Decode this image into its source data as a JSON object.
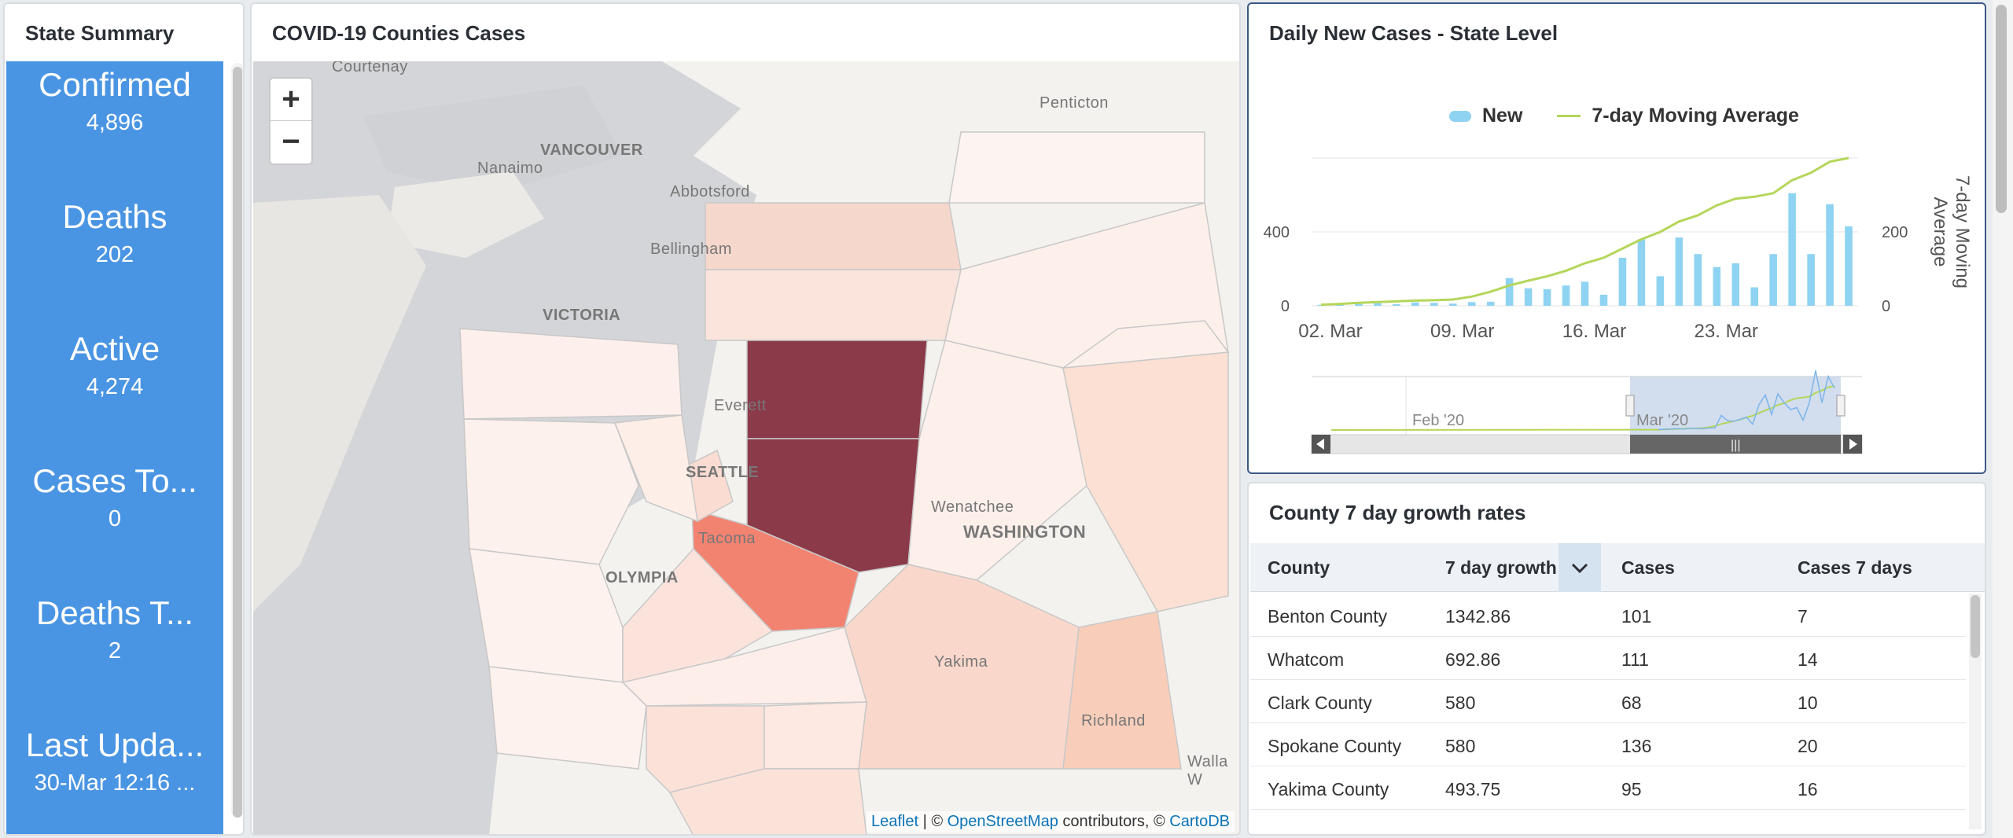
{
  "summary": {
    "title": "State Summary",
    "items": [
      {
        "label": "Confirmed",
        "value": "4,896"
      },
      {
        "label": "Deaths",
        "value": "202"
      },
      {
        "label": "Active",
        "value": "4,274"
      },
      {
        "label": "Cases To...",
        "value": "0"
      },
      {
        "label": "Deaths T...",
        "value": "2"
      },
      {
        "label": "Last Upda...",
        "value": "30-Mar 12:16 ..."
      }
    ]
  },
  "map": {
    "title": "COVID-19 Counties Cases",
    "zoom_in": "+",
    "zoom_out": "−",
    "places": [
      "Courtenay",
      "Penticton",
      "VANCOUVER",
      "Nanaimo",
      "Abbotsford",
      "Bellingham",
      "VICTORIA",
      "Everett",
      "SEATTLE",
      "Tacoma",
      "OLYMPIA",
      "Wenatchee",
      "WASHINGTON",
      "Yakima",
      "Richland",
      "Walla W"
    ],
    "attribution": {
      "leaflet": "Leaflet",
      "sep1": " | © ",
      "osm": "OpenStreetMap",
      "mid": " contributors, © ",
      "carto": "CartoDB"
    },
    "colors": {
      "water": "#d4d5d8",
      "land": "#f3f2ef",
      "darkest": "#8b3a49",
      "high": "#f38371"
    }
  },
  "chart": {
    "title": "Daily New Cases - State Level",
    "legend_new": "New",
    "legend_avg": "7-day Moving Average",
    "navigator_labels": [
      "Feb '20",
      "Mar '20"
    ]
  },
  "chart_data": {
    "type": "bar",
    "title": "Daily New Cases - State Level",
    "x_tick_labels": [
      "02. Mar",
      "09. Mar",
      "16. Mar",
      "23. Mar"
    ],
    "y_left": {
      "ticks": [
        "0",
        "400"
      ],
      "range": [
        0,
        800
      ]
    },
    "y_right": {
      "label": "7-day Moving Average",
      "ticks": [
        "0",
        "200"
      ],
      "range": [
        0,
        400
      ]
    },
    "dates": [
      "Mar 1",
      "Mar 2",
      "Mar 3",
      "Mar 4",
      "Mar 5",
      "Mar 6",
      "Mar 7",
      "Mar 8",
      "Mar 9",
      "Mar 10",
      "Mar 11",
      "Mar 12",
      "Mar 13",
      "Mar 14",
      "Mar 15",
      "Mar 16",
      "Mar 17",
      "Mar 18",
      "Mar 19",
      "Mar 20",
      "Mar 21",
      "Mar 22",
      "Mar 23",
      "Mar 24",
      "Mar 25",
      "Mar 26",
      "Mar 27",
      "Mar 28",
      "Mar 29"
    ],
    "series": [
      {
        "name": "New",
        "type": "bar",
        "color": "#8fd3f2",
        "values": [
          5,
          8,
          10,
          14,
          9,
          18,
          16,
          12,
          20,
          22,
          150,
          95,
          90,
          110,
          130,
          60,
          260,
          360,
          160,
          370,
          280,
          210,
          230,
          100,
          280,
          610,
          280,
          550,
          430
        ]
      },
      {
        "name": "7-day Moving Average",
        "type": "line",
        "color": "#b5d65a",
        "values": [
          3,
          5,
          8,
          10,
          12,
          14,
          15,
          17,
          25,
          38,
          55,
          68,
          80,
          95,
          115,
          130,
          155,
          180,
          200,
          228,
          245,
          272,
          290,
          295,
          305,
          340,
          360,
          390,
          400
        ]
      }
    ]
  },
  "table": {
    "title": "County 7 day growth rates",
    "headers": [
      "County",
      "7 day growth",
      "Cases",
      "Cases 7 days"
    ],
    "rows": [
      [
        "Benton County",
        "1342.86",
        "101",
        "7"
      ],
      [
        "Whatcom",
        "692.86",
        "111",
        "14"
      ],
      [
        "Clark County",
        "580",
        "68",
        "10"
      ],
      [
        "Spokane County",
        "580",
        "136",
        "20"
      ],
      [
        "Yakima County",
        "493.75",
        "95",
        "16"
      ]
    ]
  }
}
